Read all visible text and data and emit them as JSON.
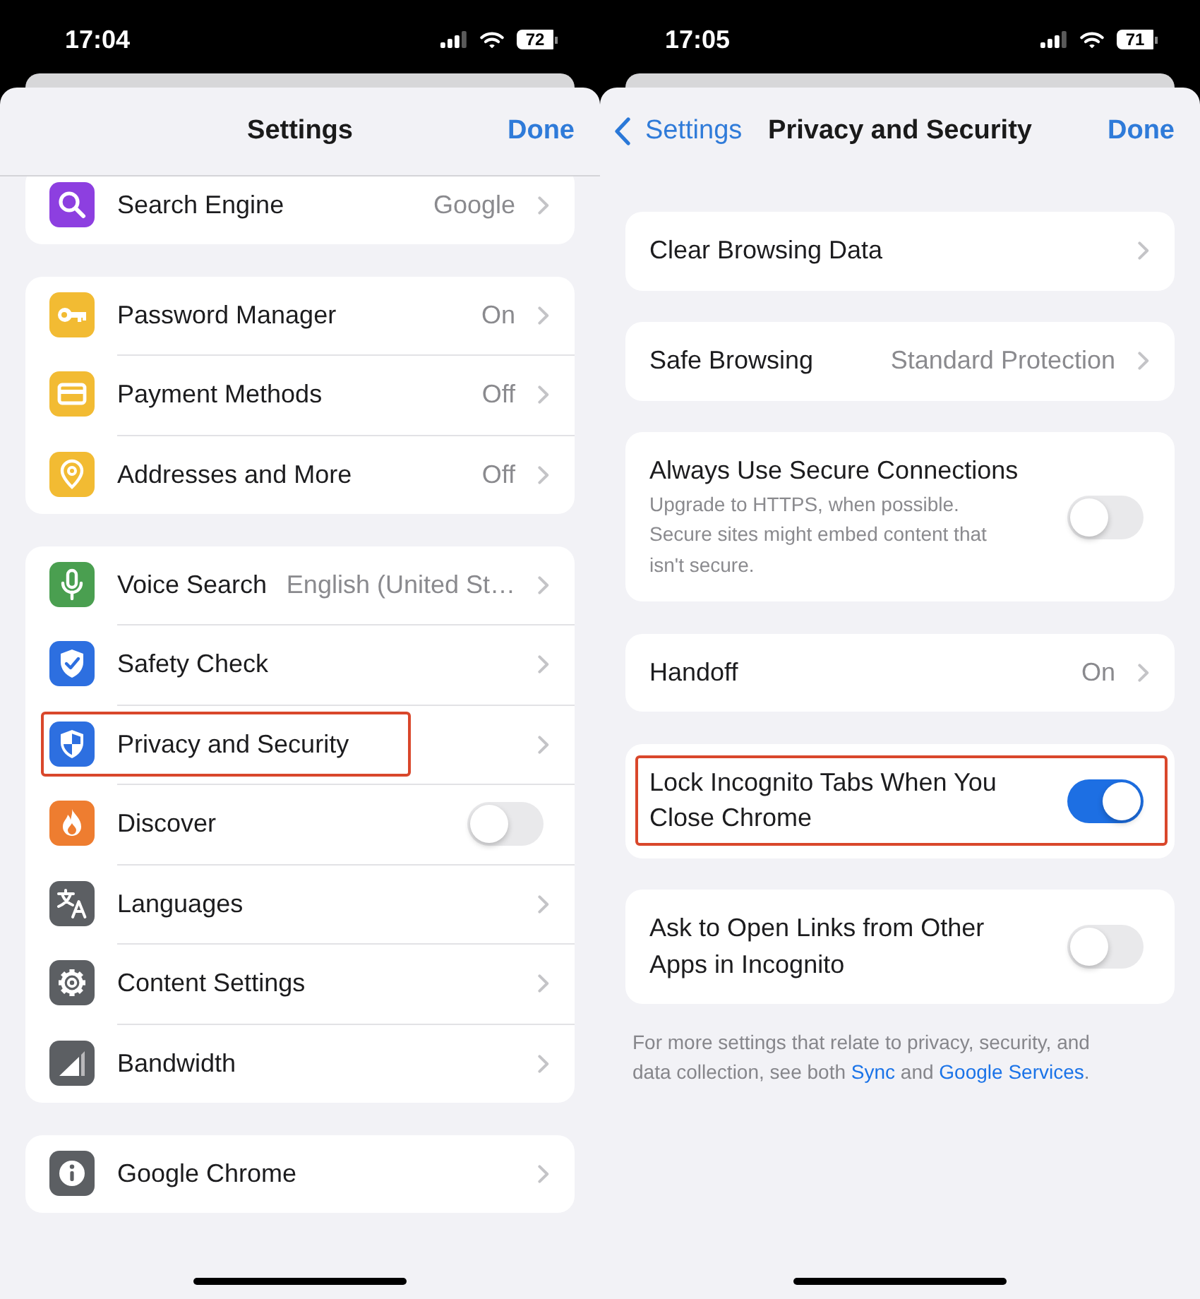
{
  "screens": [
    {
      "status_bar": {
        "time": "17:04",
        "battery": "72"
      },
      "nav_bar": {
        "title": "Settings",
        "done": "Done"
      },
      "scrolled": true,
      "groups": [
        {
          "rows": [
            {
              "kind": "link",
              "label": "Search Engine",
              "value": "Google",
              "highlighted": false
            }
          ]
        },
        {
          "rows": [
            {
              "kind": "link",
              "label": "Password Manager",
              "value": "On",
              "highlighted": false
            },
            {
              "kind": "link",
              "label": "Payment Methods",
              "value": "Off",
              "highlighted": false
            },
            {
              "kind": "link",
              "label": "Addresses and More",
              "value": "Off",
              "highlighted": false
            }
          ]
        },
        {
          "rows": [
            {
              "kind": "link",
              "label": "Voice Search",
              "value": "English (United St…",
              "highlighted": false
            },
            {
              "kind": "link",
              "label": "Safety Check",
              "highlighted": false
            },
            {
              "kind": "link",
              "label": "Privacy and Security",
              "highlighted": true
            },
            {
              "kind": "toggle",
              "label": "Discover",
              "on": false,
              "highlighted": false
            },
            {
              "kind": "link",
              "label": "Languages",
              "highlighted": false
            },
            {
              "kind": "link",
              "label": "Content Settings",
              "highlighted": false
            },
            {
              "kind": "link",
              "label": "Bandwidth",
              "highlighted": false
            }
          ]
        },
        {
          "rows": [
            {
              "kind": "link",
              "label": "Google Chrome",
              "highlighted": false
            }
          ]
        }
      ]
    },
    {
      "status_bar": {
        "time": "17:05",
        "battery": "71"
      },
      "nav_bar": {
        "back": "Settings",
        "title": "Privacy and Security",
        "done": "Done"
      },
      "scrolled": false,
      "groups": [
        {
          "rows": [
            {
              "kind": "link",
              "label": "Clear Browsing Data",
              "highlighted": false
            }
          ]
        },
        {
          "rows": [
            {
              "kind": "link",
              "label": "Safe Browsing",
              "value": "Standard Protection",
              "highlighted": false
            }
          ]
        },
        {
          "rows": [
            {
              "kind": "toggle",
              "label": "Always Use Secure Connections",
              "subtitle": "Upgrade to HTTPS, when possible. Secure sites might embed content that isn't secure.",
              "on": false,
              "highlighted": false
            }
          ]
        },
        {
          "rows": [
            {
              "kind": "link",
              "label": "Handoff",
              "value": "On",
              "highlighted": false
            }
          ]
        },
        {
          "rows": [
            {
              "kind": "toggle",
              "label": "Lock Incognito Tabs When You Close Chrome",
              "on": true,
              "highlighted": true
            }
          ]
        },
        {
          "rows": [
            {
              "kind": "toggle",
              "label": "Ask to Open Links from Other Apps in Incognito",
              "on": false,
              "highlighted": false
            }
          ]
        }
      ],
      "footer": [
        {
          "kind": "text",
          "text": "For more settings that relate to privacy, security, and data collection, see both "
        },
        {
          "kind": "link",
          "text": "Sync"
        },
        {
          "kind": "text",
          "text": " and "
        },
        {
          "kind": "link",
          "text": "Google Services"
        },
        {
          "kind": "text",
          "text": "."
        }
      ]
    }
  ]
}
